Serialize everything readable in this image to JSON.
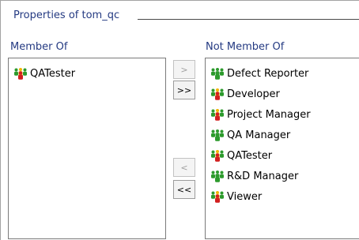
{
  "group": {
    "title": "Properties of tom_qc"
  },
  "member_of": {
    "label": "Member Of",
    "items": [
      {
        "label": "QATester",
        "icon": "user-group-mixed-icon"
      }
    ]
  },
  "not_member_of": {
    "label": "Not Member Of",
    "items": [
      {
        "label": "Defect Reporter",
        "icon": "user-group-green-icon"
      },
      {
        "label": "Developer",
        "icon": "user-group-mixed-icon"
      },
      {
        "label": "Project Manager",
        "icon": "user-group-mixed-icon"
      },
      {
        "label": "QA Manager",
        "icon": "user-group-green-icon"
      },
      {
        "label": "QATester",
        "icon": "user-group-mixed-icon"
      },
      {
        "label": "R&D Manager",
        "icon": "user-group-green-icon"
      },
      {
        "label": "Viewer",
        "icon": "user-group-mixed-icon"
      }
    ]
  },
  "buttons": {
    "add_selected": ">",
    "add_all": ">>",
    "remove_selected": "<",
    "remove_all": "<<"
  },
  "colors": {
    "label_text": "#243a82",
    "icon_red": "#d21f1f",
    "icon_green": "#2c9a2c",
    "icon_yellow": "#f1b400"
  }
}
